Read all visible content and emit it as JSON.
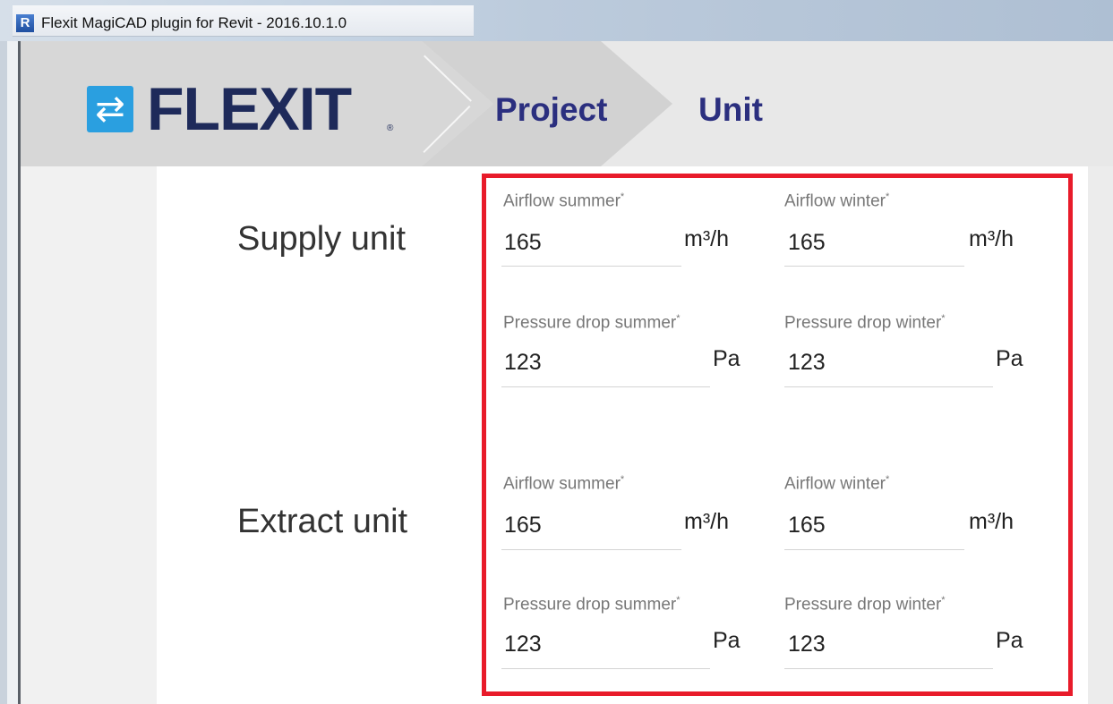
{
  "window": {
    "title": "Flexit MagiCAD plugin for Revit - 2016.10.1.0",
    "app_icon_letter": "R"
  },
  "header": {
    "logo": {
      "icon": "double-arrow-icon",
      "text": "FLEXIT",
      "mark": "®"
    },
    "breadcrumbs": [
      {
        "label": "Project"
      },
      {
        "label": "Unit"
      }
    ]
  },
  "colors": {
    "highlight": "#e81b2a",
    "brand_navy": "#1e2a5a",
    "brand_blue": "#2a9fe0",
    "crumb": "#2b2f7f"
  },
  "sections": [
    {
      "label": "Supply unit",
      "fields": [
        {
          "label": "Airflow summer",
          "required": "*",
          "value": "165",
          "unit": "m³/h"
        },
        {
          "label": "Airflow winter",
          "required": "*",
          "value": "165",
          "unit": "m³/h"
        },
        {
          "label": "Pressure drop summer",
          "required": "*",
          "value": "123",
          "unit": "Pa"
        },
        {
          "label": "Pressure drop winter",
          "required": "*",
          "value": "123",
          "unit": "Pa"
        }
      ]
    },
    {
      "label": "Extract unit",
      "fields": [
        {
          "label": "Airflow summer",
          "required": "*",
          "value": "165",
          "unit": "m³/h"
        },
        {
          "label": "Airflow winter",
          "required": "*",
          "value": "165",
          "unit": "m³/h"
        },
        {
          "label": "Pressure drop summer",
          "required": "*",
          "value": "123",
          "unit": "Pa"
        },
        {
          "label": "Pressure drop winter",
          "required": "*",
          "value": "123",
          "unit": "Pa"
        }
      ]
    }
  ]
}
